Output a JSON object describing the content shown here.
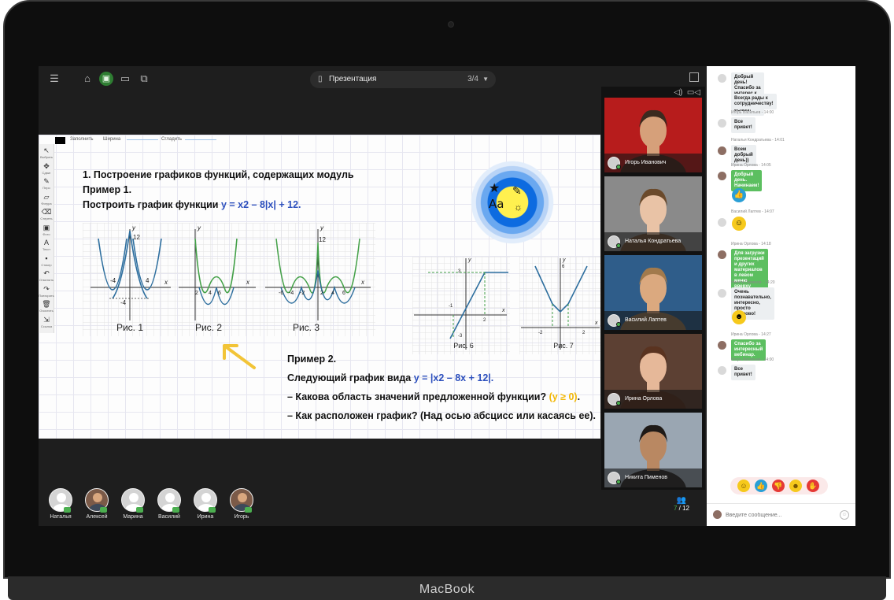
{
  "device": {
    "label": "MacBook"
  },
  "topbar": {
    "presentation_title": "Презентация",
    "page_indicator": "3/4"
  },
  "slide": {
    "options": {
      "fill_label": "Заполнить",
      "width_label": "Ширина",
      "smooth_label": "Сгладить"
    },
    "tools": [
      {
        "icon": "cursor-icon",
        "glyph": "↖",
        "label": "Выбрать"
      },
      {
        "icon": "move-icon",
        "glyph": "✥",
        "label": "Сдвиг"
      },
      {
        "icon": "pen-icon",
        "glyph": "✎",
        "label": "Перо"
      },
      {
        "icon": "shape-icon",
        "glyph": "▱",
        "label": "Фигура"
      },
      {
        "icon": "eraser-icon",
        "glyph": "⌫",
        "label": "Стереть"
      },
      {
        "icon": "image-icon",
        "glyph": "▣",
        "label": "Фото"
      },
      {
        "icon": "text-icon",
        "glyph": "A",
        "label": "Текст"
      },
      {
        "icon": "sticker-icon",
        "glyph": "▪",
        "label": "Стикер"
      },
      {
        "icon": "undo-icon",
        "glyph": "↶",
        "label": "Отменить"
      },
      {
        "icon": "redo-icon",
        "glyph": "↷",
        "label": "Повторить"
      },
      {
        "icon": "trash-icon",
        "glyph": "🗑",
        "label": "Очистить"
      },
      {
        "icon": "export-icon",
        "glyph": "⇲",
        "label": "Ссылка"
      }
    ],
    "heading": "1. Построение графиков функций, содержащих модуль",
    "example1": "Пример 1.",
    "task1_prefix": "Построить график функции ",
    "task1_formula": "y = x2 – 8|x| + 12.",
    "fig_labels": [
      "Рис. 1",
      "Рис. 2",
      "Рис. 3",
      "Рис. 6",
      "Рис. 7"
    ],
    "example2": "Пример 2.",
    "task2_prefix": "Следующий график вида ",
    "task2_formula": "y = |x2 – 8x + 12|.",
    "q1_prefix": "– Какова область значений предложенной функции? ",
    "q1_answer": "(y ≥ 0)",
    "q1_suffix": ".",
    "q2": "– Как расположен график? (Над осью абсцисс или касаясь ее).",
    "sticker_text": "Aa"
  },
  "videos": [
    {
      "name": "Игорь Иванович",
      "bg": "#b71c1c",
      "skin": "#d6a07a",
      "hair": "#3b2a1f"
    },
    {
      "name": "Наталья Кондратьева",
      "bg": "#8a8a8a",
      "skin": "#e9c3a6",
      "hair": "#6b4a2b"
    },
    {
      "name": "Василий Лаптев",
      "bg": "#2f5d8a",
      "skin": "#dba97f",
      "hair": "#a27a4c"
    },
    {
      "name": "Ирина Орлова",
      "bg": "#5c4033",
      "skin": "#e6b899",
      "hair": "#5a3320"
    },
    {
      "name": "Никита Пименов",
      "bg": "#9aa6b2",
      "skin": "#b98862",
      "hair": "#1f1a17"
    }
  ],
  "participants": [
    {
      "name": "Наталья",
      "photo": false
    },
    {
      "name": "Алексей",
      "photo": true
    },
    {
      "name": "Марина",
      "photo": false
    },
    {
      "name": "Василий",
      "photo": false
    },
    {
      "name": "Ирина",
      "photo": false
    },
    {
      "name": "Игорь",
      "photo": true
    }
  ],
  "participant_count": {
    "current": "7",
    "total": "12"
  },
  "chat": {
    "messages": [
      {
        "meta": "",
        "text": "Добрый день! Спасибо за интерес к нашей платформе eClass!",
        "style": "grey"
      },
      {
        "meta": "",
        "text": "Всегда рады к сотрудничеству!",
        "style": "grey"
      },
      {
        "meta": "Игорь Васильев - 14:00",
        "text": "Все привет!",
        "style": "grey"
      },
      {
        "meta": "Наталья Кондратьева - 14:01",
        "text": "Всем добрый день))",
        "style": "grey"
      },
      {
        "meta": "Ирина Орлова - 14:05",
        "text": "Добрый день. Начинаем!",
        "style": "green"
      },
      {
        "meta": "Василий Лаптев - 14:07",
        "text": "",
        "style": "emoji"
      },
      {
        "meta": "Ирина Орлова - 14:18",
        "text": "Для загрузки презентаций и других материалов в левом меню вверху откройте \"Редактор материалов\"",
        "style": "green"
      },
      {
        "meta": "Никита Пименов - 14:20",
        "text": "Очень познавательно, интересно, просто здорово!",
        "style": "grey"
      },
      {
        "meta": "Ирина Орлова - 14:27",
        "text": "Спасибо за интересный вебинар.",
        "style": "green"
      },
      {
        "meta": "Игорь Васильев - 14:00",
        "text": "Все привет!",
        "style": "grey"
      }
    ],
    "input_placeholder": "Введите сообщение..."
  },
  "colors": {
    "accent_green": "#5cbf60",
    "formula_blue": "#2c4fbd",
    "answer_yellow": "#f2b705"
  }
}
